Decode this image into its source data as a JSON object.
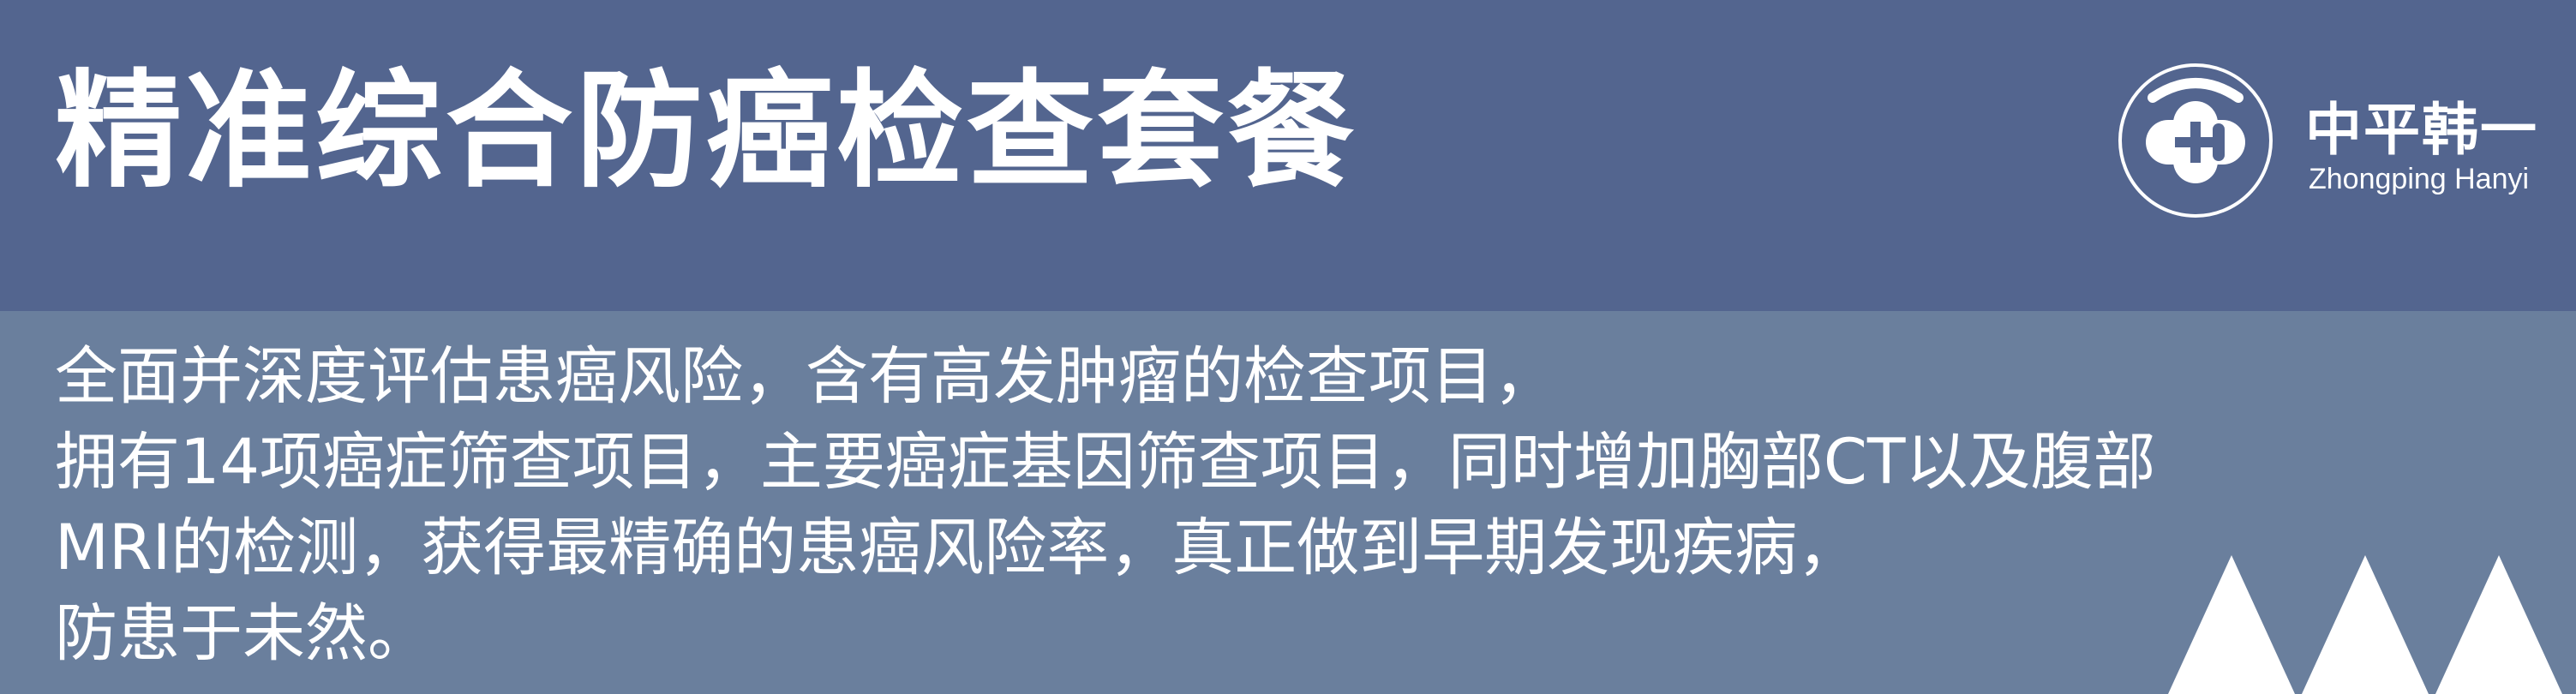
{
  "title": "精准综合防癌检查套餐",
  "brand": {
    "name_cn": "中平韩一",
    "name_en": "Zhongping Hanyi",
    "logo_icon": "medical-cross-logo-icon"
  },
  "description": {
    "lines": [
      "全面并深度评估患癌风险，含有高发肿瘤的检查项目，",
      "拥有14项癌症筛查项目，主要癌症基因筛查项目，同时增加胸部CT以及腹部",
      "MRI的检测，获得最精确的患癌风险率，真正做到早期发现疾病，",
      "防患于未然。"
    ]
  },
  "colors": {
    "header_background": "#53658f",
    "body_background": "#6a7f9d",
    "text": "#ffffff"
  }
}
